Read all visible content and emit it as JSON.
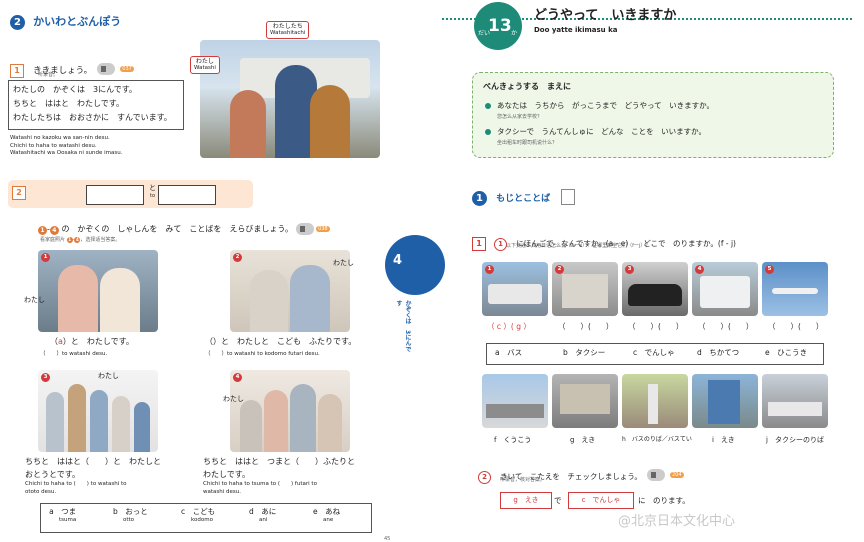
{
  "left": {
    "section_num": "2",
    "section_title": "かいわとぶんぽう",
    "ex1": {
      "num": "1",
      "instruction": "ききましょう。",
      "instruction_cn": "听录音。",
      "audio": "037",
      "lines": [
        "わたしの　かぞくは　3にんです。",
        "ちちと　ははと　わたしです。",
        "わたしたちは　おおさかに　すんでいます。"
      ],
      "romaji": [
        "Watashi no kazoku wa san-nin desu.",
        "Chichi to haha to watashi desu.",
        "Watashitachi wa Oosaka ni sunde imasu."
      ],
      "photo_tags": {
        "watashitachi": "わたしたち",
        "watashitachi_rom": "Watashitachi",
        "watashi": "わたし",
        "watashi_rom": "Watashi"
      }
    },
    "ex2": {
      "num": "2",
      "to": "と",
      "to_rom": "to",
      "instruction": "の　かぞくの　しゃしんを　みて　ことばを　えらびましょう。",
      "n1": "1",
      "dash": "-",
      "n4": "4",
      "instruction_cn_a": "看家庭照片",
      "instruction_cn_b": "，选择适当答案。",
      "audio": "038",
      "items": [
        {
          "num": "1",
          "tag": "わたし",
          "answer_pre": "（",
          "answer": "a",
          "answer_post": "）と　わたしです。",
          "romaji": "（　　）to watashi desu."
        },
        {
          "num": "2",
          "tag": "わたし",
          "answer_pre": "（",
          "answer": "",
          "answer_post": "）と　わたしと　こども　ふたりです。",
          "romaji": "（　　）to watashi to kodomo futari desu."
        },
        {
          "num": "3",
          "tag": "わたし",
          "line1": "ちちと　ははと（　　）と　わたしと",
          "line2": "おとうとです。",
          "romaji1": "Chichi to haha to (　　) to watashi to",
          "romaji2": "ototo desu."
        },
        {
          "num": "4",
          "tag": "わたし",
          "line1": "ちちと　ははと　つまと（　　）ふたりと",
          "line2": "わたしです。",
          "romaji1": "Chichi to haha to tsuma to (　　) futari to",
          "romaji2": "watashi desu."
        }
      ],
      "choices": [
        {
          "letter": "a",
          "word": "つま",
          "romaji": "tsuma"
        },
        {
          "letter": "b",
          "word": "おっと",
          "romaji": "otto"
        },
        {
          "letter": "c",
          "word": "こども",
          "romaji": "kodomo"
        },
        {
          "letter": "d",
          "word": "あに",
          "romaji": "ani"
        },
        {
          "letter": "e",
          "word": "あね",
          "romaji": "ane"
        }
      ]
    },
    "side_tab_num": "4",
    "side_tab_text": "かぞくは　3にんです",
    "page_num": "45"
  },
  "right": {
    "lesson_prefix": "だい",
    "lesson_num": "13",
    "lesson_suffix": "か",
    "title": "どうやって　いきますか",
    "title_rom": "Doo yatte ikimasu ka",
    "study": {
      "heading": "べんきょうする　まえに",
      "q1": "あなたは　うちから　がっこうまで　どうやって　いきますか。",
      "q1_cn": "您怎么从家去学校？",
      "q2": "タクシーで　うんてんしゅに　どんな　ことを　いいますか。",
      "q2_cn": "坐出租车时跟司机说什么？"
    },
    "sec1": {
      "num": "1",
      "title": "もじとことば",
      "icon": "book-icon"
    },
    "ex1": {
      "box_num": "1",
      "sub_num": "1",
      "instruction": "にほんごで　なんですか。(a - e)　　どこで　のりますか。(f - j)",
      "instruction_cn": "以下交通工具用日语怎么说（a一e）？在哪里乘坐它们（f一j）？",
      "photos": [
        "1",
        "2",
        "3",
        "4",
        "5"
      ],
      "answers": [
        "（ c ）( g ）",
        "（　　）(　　）",
        "（　　）(　　）",
        "（　　）(　　）",
        "（　　）(　　）"
      ],
      "vehicles": [
        {
          "letter": "a",
          "word": "バス"
        },
        {
          "letter": "b",
          "word": "タクシー"
        },
        {
          "letter": "c",
          "word": "でんしゃ"
        },
        {
          "letter": "d",
          "word": "ちかてつ"
        },
        {
          "letter": "e",
          "word": "ひこうき"
        }
      ],
      "places": [
        {
          "letter": "f",
          "word": "くうこう"
        },
        {
          "letter": "g",
          "word": "えき"
        },
        {
          "letter": "h",
          "word": "バスのりば／バスてい"
        },
        {
          "letter": "i",
          "word": "えき"
        },
        {
          "letter": "j",
          "word": "タクシーのりば"
        }
      ]
    },
    "ex2": {
      "sub_num": "2",
      "instruction": "きいて　こたえを　チェックしましょう。",
      "instruction_cn": "听录音，核对答案。",
      "audio": "204",
      "box1": "g　えき",
      "de": "で",
      "box2": "c　でんしゃ",
      "tail": "に　のります。"
    }
  },
  "watermark": "@北京日本文化中心",
  "colors": {
    "blue": "#1f5fa8",
    "teal": "#1e8a78",
    "orange": "#e07a3a",
    "red": "#d23b3b",
    "green_bg": "#eef7e8"
  }
}
